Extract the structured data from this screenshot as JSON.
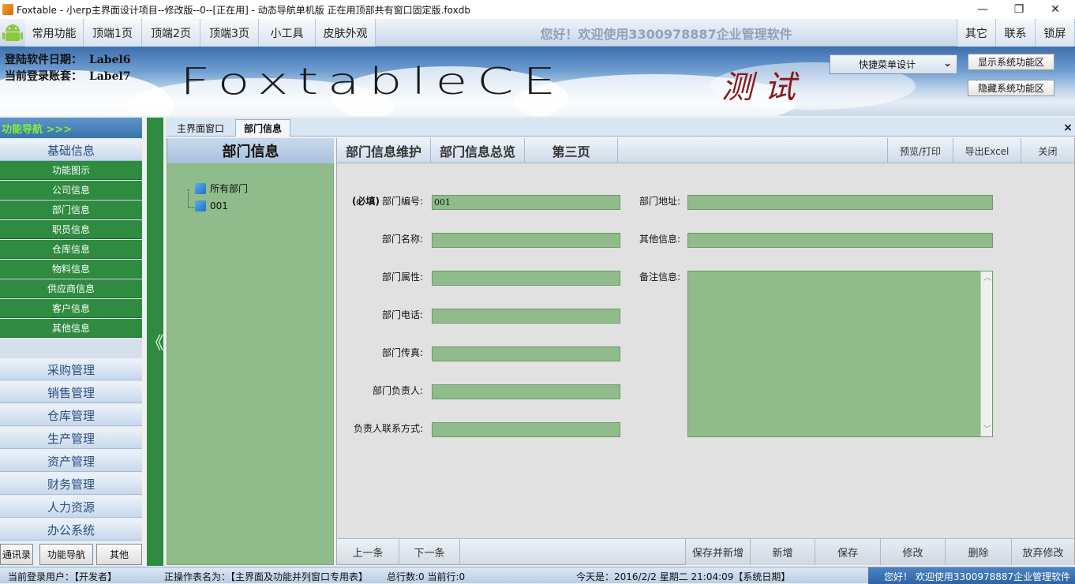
{
  "window": {
    "title": "Foxtable - 小erp主界面设计项目--修改版--0--[正在用] - 动态导航单机版 正在用顶部共有窗口固定版.foxdb",
    "minimize": "—",
    "maximize": "❐",
    "close": "✕"
  },
  "menubar": {
    "items": [
      "常用功能",
      "顶端1页",
      "顶端2页",
      "顶端3页",
      "小工具",
      "皮肤外观"
    ],
    "welcome": "您好！欢迎使用3300978887企业管理软件",
    "right_items": [
      "其它",
      "联系",
      "锁屏"
    ]
  },
  "banner": {
    "login_date_label": "登陆软件日期：",
    "login_date_value": "Label6",
    "account_label": "当前登录账套：",
    "account_value": "Label7",
    "logo_text": "FoxtableCE",
    "test_text": "测试",
    "quick_menu": "快捷菜单设计",
    "show_sys": "显示系统功能区",
    "hide_sys": "隐藏系统功能区"
  },
  "nav": {
    "header": "功能导航 >>>",
    "basic": "基础信息",
    "sub_items": [
      "功能图示",
      "公司信息",
      "部门信息",
      "职员信息",
      "仓库信息",
      "物料信息",
      "供应商信息",
      "客户信息",
      "其他信息"
    ],
    "categories": [
      "采购管理",
      "销售管理",
      "仓库管理",
      "生产管理",
      "资产管理",
      "财务管理",
      "人力资源",
      "办公系统"
    ],
    "bottom": [
      "通讯录",
      "功能导航",
      "其他"
    ],
    "splitter": "《"
  },
  "tabs": {
    "items": [
      "主界面窗口",
      "部门信息"
    ],
    "close": "×"
  },
  "tree": {
    "title": "部门信息",
    "nodes": [
      "所有部门",
      "001"
    ]
  },
  "subtabs": {
    "left": [
      "部门信息维护",
      "部门信息总览",
      "第三页"
    ],
    "right": [
      "预览/打印",
      "导出Excel",
      "关闭"
    ]
  },
  "form": {
    "required": "(必填)",
    "dept_no_label": "部门编号:",
    "dept_no_value": "001",
    "dept_name_label": "部门名称:",
    "dept_attr_label": "部门属性:",
    "dept_phone_label": "部门电话:",
    "dept_fax_label": "部门传真:",
    "dept_head_label": "部门负责人:",
    "head_contact_label": "负责人联系方式:",
    "dept_addr_label": "部门地址:",
    "other_info_label": "其他信息:",
    "remark_label": "备注信息:"
  },
  "actions": {
    "prev": "上一条",
    "next": "下一条",
    "right": [
      "保存并新增",
      "新增",
      "保存",
      "修改",
      "删除",
      "放弃修改"
    ]
  },
  "status": {
    "user": "当前登录用户：【开发者】",
    "table": "正操作表名为：【主界面及功能并列窗口专用表】",
    "rows": "总行数:0  当前行:0",
    "date": "今天是：2016/2/2 星期二 21:04:09【系统日期】",
    "welcome": "您好！ 欢迎使用3300978887企业管理软件"
  },
  "colors": {
    "nav_green": "#2e8b3f",
    "field_green": "#8fbc8a",
    "header_blue": "#3a73ae"
  }
}
